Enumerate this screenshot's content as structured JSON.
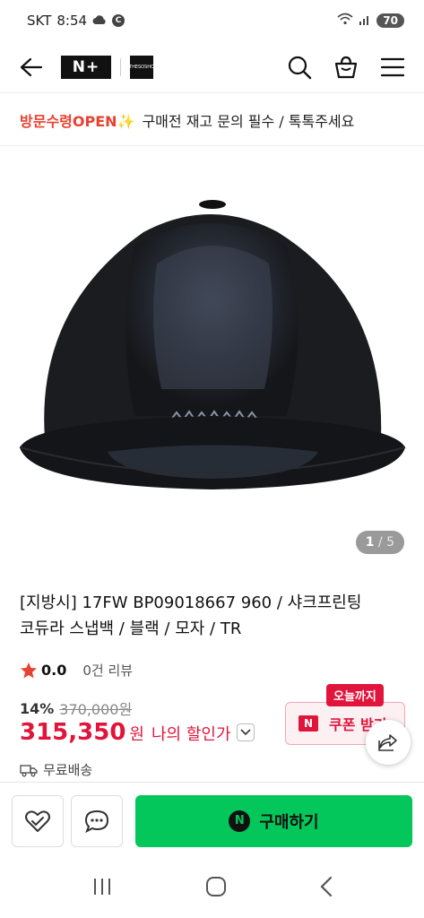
{
  "status": {
    "carrier": "SKT",
    "time": "8:54",
    "battery": "70",
    "c_badge": "C"
  },
  "header": {
    "logo": "N+",
    "brand2": "THESOSHO"
  },
  "notice": {
    "highlight": "방문수령OPEN✨",
    "text": "구매전 재고 문의 필수 / 톡톡주세요"
  },
  "gallery": {
    "current": "1",
    "total": "/ 5"
  },
  "product": {
    "title_line1": "[지방시] 17FW BP09018667 960 / 샤크프린팅",
    "title_line2": "코듀라 스냅백 / 블랙 / 모자 / TR",
    "rating": "0.0",
    "reviews": "0건 리뷰",
    "discount_pct": "14%",
    "original_price": "370,000원",
    "price": "315,350",
    "won": "원",
    "my_price_label": "나의 할인가",
    "shipping": "무료배송"
  },
  "coupon": {
    "tag": "오늘까지",
    "n": "N",
    "label": "쿠폰 받기"
  },
  "bottom": {
    "buy_label": "구매하기",
    "n": "N"
  },
  "colors": {
    "accent_red": "#e1143b",
    "buy_green": "#03c75a",
    "notice_red": "#e9412f"
  },
  "icons": [
    "back-icon",
    "search-icon",
    "cart-icon",
    "menu-icon",
    "star-icon",
    "truck-icon",
    "share-icon",
    "wishlist-icon",
    "chat-icon",
    "recent-apps-icon",
    "home-icon",
    "nav-back-icon"
  ]
}
